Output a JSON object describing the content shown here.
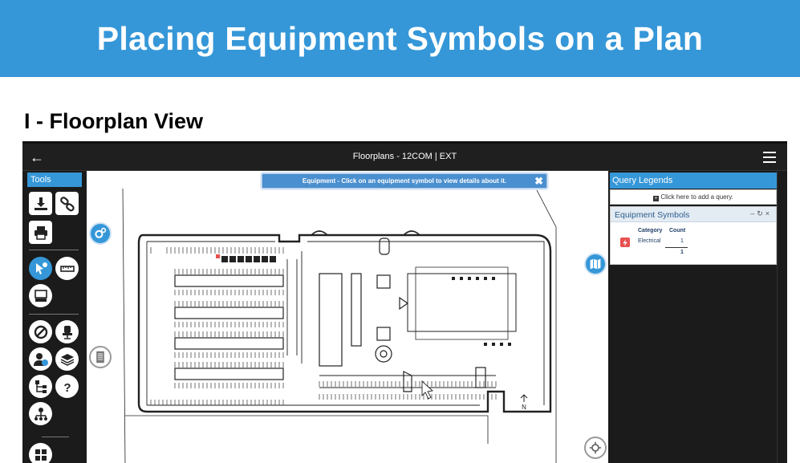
{
  "banner": {
    "title": "Placing Equipment Symbols on a Plan"
  },
  "section": {
    "title": "I - Floorplan View"
  },
  "app": {
    "header_title": "Floorplans - 12COM | EXT",
    "tools_label": "Tools",
    "equipment_notice": "Equipment - Click on an equipment symbol to view details about it.",
    "query_legends": {
      "title": "Query Legends",
      "add_query": "Click here to add a query."
    },
    "equipment_symbols": {
      "title": "Equipment Symbols",
      "col_category": "Category",
      "col_count": "Count",
      "rows": [
        {
          "category": "Electrical",
          "count": "1"
        }
      ],
      "total": "1"
    },
    "plan_labels": {
      "north": "N"
    }
  },
  "colors": {
    "banner": "#3597d8",
    "accent": "#3597d8",
    "electrical": "#e8504f",
    "dark": "#1b1b1b"
  }
}
